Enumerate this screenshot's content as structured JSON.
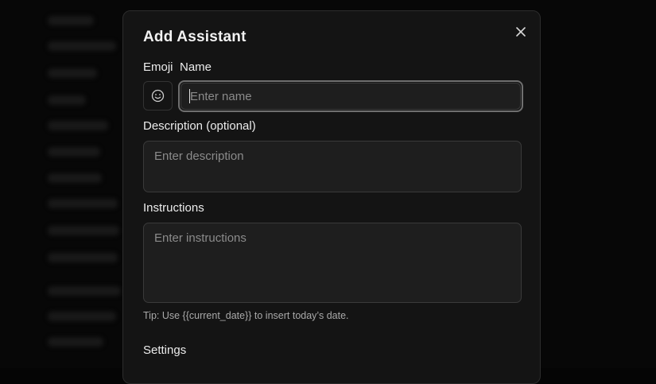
{
  "dialog": {
    "title": "Add Assistant",
    "close_icon": "close-icon"
  },
  "fields": {
    "emoji_label": "Emoji",
    "emoji_icon": "smiley-face-icon",
    "name_label": "Name",
    "name_placeholder": "Enter name",
    "name_value": "",
    "description_label": "Description (optional)",
    "description_placeholder": "Enter description",
    "instructions_label": "Instructions",
    "instructions_placeholder": "Enter instructions",
    "tip": "Tip: Use {{current_date}} to insert today’s date.",
    "settings_label": "Settings"
  },
  "colors": {
    "modal_background": "#141414",
    "input_background": "#1e1e1e",
    "focus_ring": "#6f6f6f"
  }
}
